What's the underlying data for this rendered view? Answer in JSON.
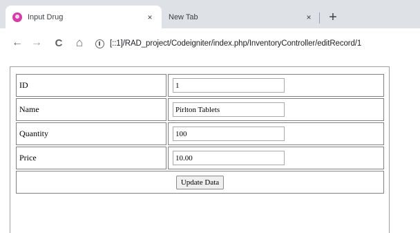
{
  "browser": {
    "tabs": [
      {
        "title": "Input Drug",
        "close": "×",
        "active": true
      },
      {
        "title": "New Tab",
        "close": "×",
        "active": false
      }
    ],
    "new_tab": "+",
    "nav": {
      "back": "←",
      "forward": "→",
      "reload": "C",
      "home": "⌂"
    },
    "url": "[::1]/RAD_project/Codeigniter/index.php/InventoryController/editRecord/1"
  },
  "form": {
    "rows": [
      {
        "label": "ID",
        "value": "1"
      },
      {
        "label": "Name",
        "value": "Pirlton Tablets"
      },
      {
        "label": "Quantity",
        "value": "100"
      },
      {
        "label": "Price",
        "value": "10.00"
      }
    ],
    "submit_label": "Update Data"
  },
  "colors": {
    "tabbar_bg": "#dee1e6",
    "favicon": "#d43fa6"
  }
}
